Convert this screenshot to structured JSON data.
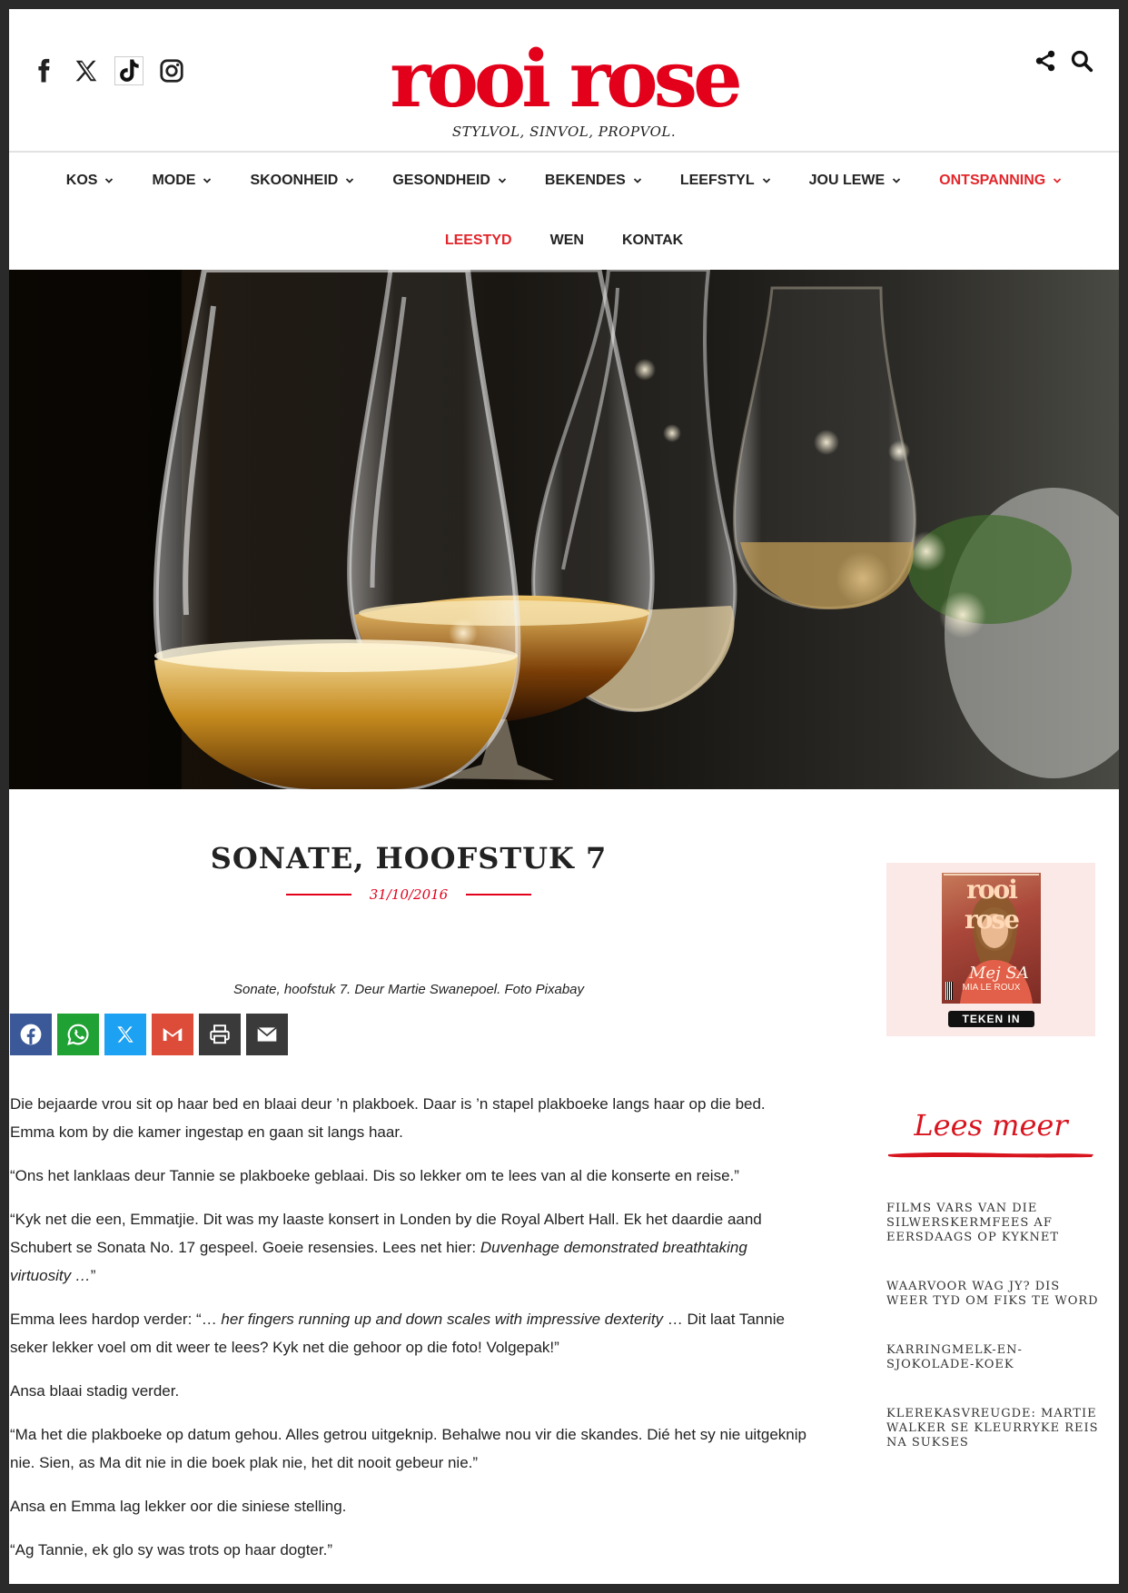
{
  "header": {
    "logo": "rooi rose",
    "tagline": "STYLVOL, SINVOL, PROPVOL.",
    "social_icons": [
      "facebook-icon",
      "x-icon",
      "tiktok-icon",
      "instagram-icon"
    ],
    "tools": [
      "share-icon",
      "search-icon"
    ]
  },
  "nav": {
    "row1": [
      {
        "label": "KOS",
        "dropdown": true
      },
      {
        "label": "MODE",
        "dropdown": true
      },
      {
        "label": "SKOONHEID",
        "dropdown": true
      },
      {
        "label": "GESONDHEID",
        "dropdown": true
      },
      {
        "label": "BEKENDES",
        "dropdown": true
      },
      {
        "label": "LEEFSTYL",
        "dropdown": true
      },
      {
        "label": "JOU LEWE",
        "dropdown": true
      },
      {
        "label": "ONTSPANNING",
        "dropdown": true,
        "active": true
      }
    ],
    "row2": [
      {
        "label": "LEESTYD",
        "active": true
      },
      {
        "label": "WEN"
      },
      {
        "label": "KONTAK"
      }
    ]
  },
  "article": {
    "title": "SONATE, HOOFSTUK 7",
    "date": "31/10/2016",
    "caption": "Sonate, hoofstuk 7. Deur Martie Swanepoel. Foto Pixabay",
    "share_buttons": [
      "facebook-icon",
      "whatsapp-icon",
      "x-icon",
      "gmail-icon",
      "print-icon",
      "email-icon"
    ],
    "p1": "Die bejaarde vrou sit op haar bed en blaai deur ’n plakboek. Daar is ’n stapel plakboeke langs haar op die bed. Emma kom by die kamer ingestap en gaan sit langs haar.",
    "p2": "“Ons het lanklaas deur Tannie se plakboeke geblaai. Dis so lekker om te lees van al die konserte en reise.”",
    "p3a": "“Kyk net die een, Emmatjie. Dit was my laaste konsert in Londen by die Royal Albert Hall. Ek het daardie aand Schubert se Sonata No. 17 gespeel. Goeie resensies. Lees net hier: ",
    "p3b": "Duvenhage demonstrated breathtaking virtuosity …",
    "p3c": "”",
    "p4a": "Emma lees hardop verder: “… ",
    "p4b": "her fingers running up and down scales with impressive dexterity",
    "p4c": " … Dit laat Tannie seker lekker voel om dit weer te lees? Kyk net die gehoor op die foto! Volgepak!”",
    "p5": "Ansa blaai stadig verder.",
    "p6": "“Ma het die plakboeke op datum gehou. Alles getrou uitgeknip. Behalwe nou vir die skandes. Dié het sy nie uitgeknip nie. Sien, as Ma dit nie in die boek plak nie, het dit nooit gebeur nie.”",
    "p7": "Ansa en Emma lag lekker oor die siniese stelling.",
    "p8": "“Ag Tannie, ek glo sy was trots op haar dogter.”"
  },
  "sidebar": {
    "magazine": {
      "cover_title": "rooi rose",
      "cover_headline": "Mej SA",
      "cover_subline": "MIA LE ROUX",
      "cta": "TEKEN IN"
    },
    "lees_meer": "Lees meer",
    "links": [
      "FILMS VARS VAN DIE SILWERSKERMFEES AF EERSDAAGS OP KYKNET",
      "WAARVOOR WAG JY? DIS WEER TYD OM FIKS TE WORD",
      "KARRINGMELK-EN-SJOKOLADE-KOEK",
      "KLEREKASVREUGDE: MARTIE WALKER SE KLEURRYKE REIS NA SUKSES"
    ]
  },
  "colors": {
    "brand_red": "#e2001a",
    "facebook": "#3b5998",
    "whatsapp": "#1fa133",
    "x_blue": "#1da1f2",
    "gmail": "#dd4b39",
    "dark_button": "#3a3a3a"
  }
}
